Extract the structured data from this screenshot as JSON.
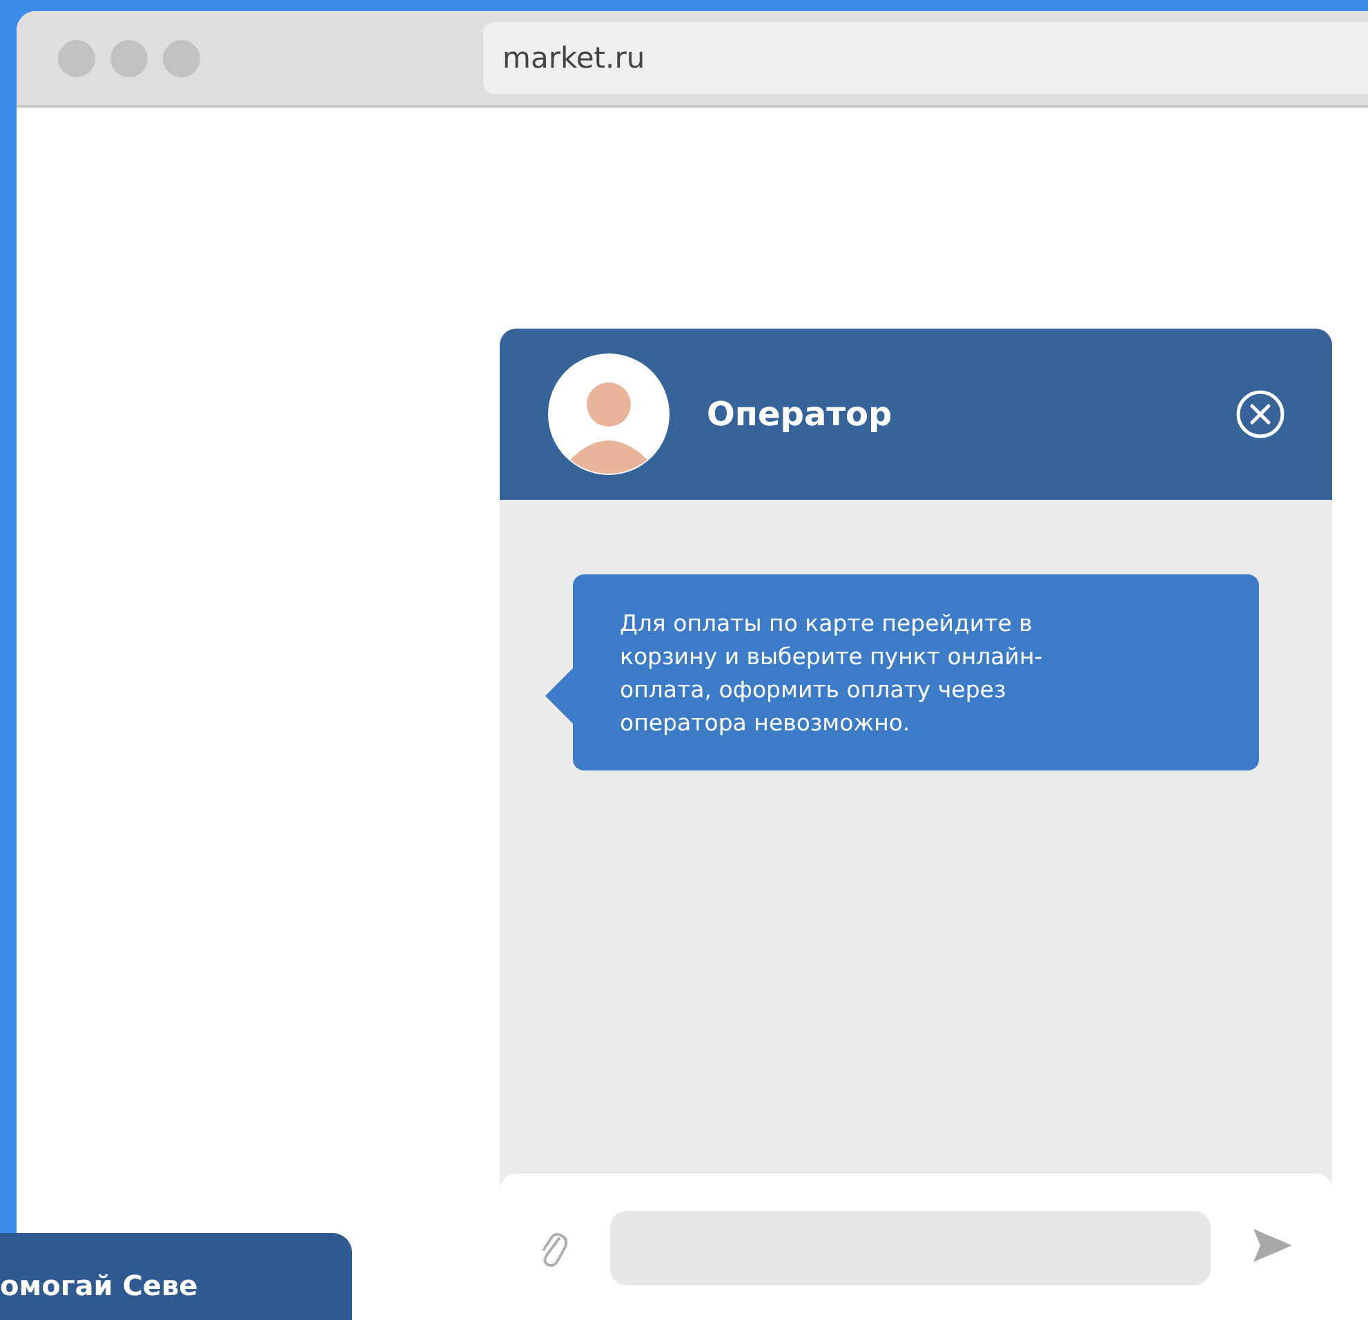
{
  "browser": {
    "address": "market.ru"
  },
  "chat": {
    "title": "Оператор",
    "messages": [
      {
        "text": "Для оплаты по карте перейдите в корзину и выберите пункт онлайн-оплата, оформить оплату через оператора невозможно."
      }
    ]
  },
  "side_tab": {
    "label": "омогай Севе"
  }
}
